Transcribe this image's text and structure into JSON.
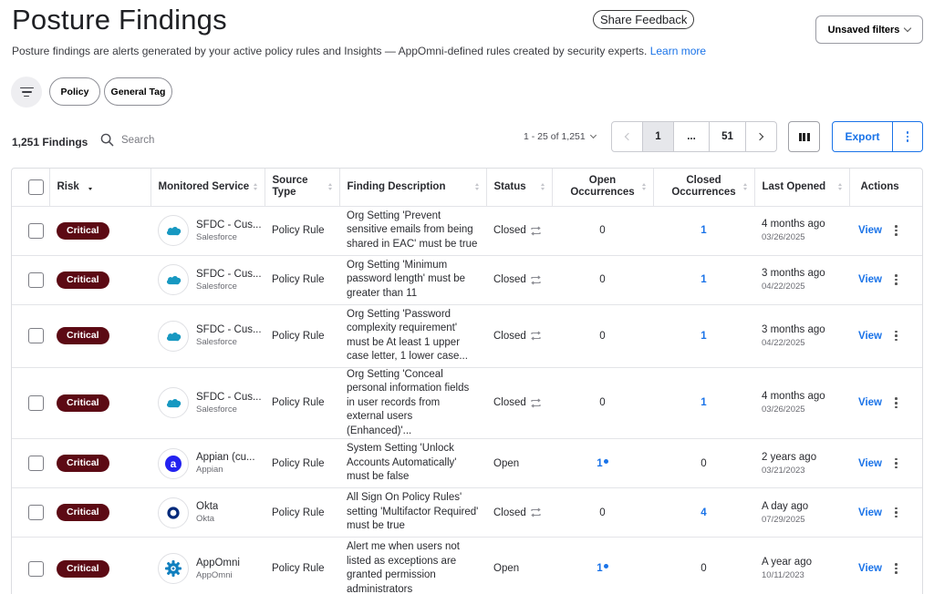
{
  "header": {
    "title": "Posture Findings",
    "feedback_label": "Share Feedback",
    "unsaved_filters_label": "Unsaved filters",
    "subtitle": "Posture findings are alerts generated by your active policy rules and Insights — AppOmni-defined rules created by security experts.",
    "learn_more": "Learn more"
  },
  "filters": {
    "chips": [
      "Policy",
      "General Tag"
    ]
  },
  "toolbar": {
    "findings_count": "1,251 Findings",
    "search_placeholder": "Search",
    "range_label": "1 - 25 of 1,251",
    "pager": {
      "current": "1",
      "ellipsis": "...",
      "last": "51"
    },
    "export_label": "Export"
  },
  "table": {
    "columns": {
      "risk": "Risk",
      "service": "Monitored Service",
      "source": "Source Type",
      "description": "Finding Description",
      "status": "Status",
      "open": "Open Occurrences",
      "closed": "Closed Occurrences",
      "last_opened": "Last Opened",
      "actions": "Actions"
    },
    "rows": [
      {
        "risk": "Critical",
        "service": "SFDC - Cus...",
        "platform": "Salesforce",
        "logo": "salesforce-icon",
        "source": "Policy Rule",
        "desc": "Org Setting 'Prevent sensitive emails from being shared in EAC' must be true",
        "status": "Closed",
        "reopen": true,
        "open": "0",
        "open_new": false,
        "closed": "1",
        "when": "4 months ago",
        "date": "03/26/2025",
        "action": "View"
      },
      {
        "risk": "Critical",
        "service": "SFDC - Cus...",
        "platform": "Salesforce",
        "logo": "salesforce-icon",
        "source": "Policy Rule",
        "desc": "Org Setting 'Minimum password length' must be greater than 11",
        "status": "Closed",
        "reopen": true,
        "open": "0",
        "open_new": false,
        "closed": "1",
        "when": "3 months ago",
        "date": "04/22/2025",
        "action": "View"
      },
      {
        "risk": "Critical",
        "service": "SFDC - Cus...",
        "platform": "Salesforce",
        "logo": "salesforce-icon",
        "source": "Policy Rule",
        "desc": "Org Setting 'Password complexity requirement' must be At least 1 upper case letter, 1 lower case...",
        "status": "Closed",
        "reopen": true,
        "open": "0",
        "open_new": false,
        "closed": "1",
        "when": "3 months ago",
        "date": "04/22/2025",
        "action": "View"
      },
      {
        "risk": "Critical",
        "service": "SFDC - Cus...",
        "platform": "Salesforce",
        "logo": "salesforce-icon",
        "source": "Policy Rule",
        "desc": "Org Setting 'Conceal personal information fields in user records from external users (Enhanced)'...",
        "status": "Closed",
        "reopen": true,
        "open": "0",
        "open_new": false,
        "closed": "1",
        "when": "4 months ago",
        "date": "03/26/2025",
        "action": "View"
      },
      {
        "risk": "Critical",
        "service": "Appian (cu...",
        "platform": "Appian",
        "logo": "appian-icon",
        "source": "Policy Rule",
        "desc": "System Setting 'Unlock Accounts Automatically' must be false",
        "status": "Open",
        "reopen": false,
        "open": "1",
        "open_new": true,
        "closed": "0",
        "when": "2 years ago",
        "date": "03/21/2023",
        "action": "View"
      },
      {
        "risk": "Critical",
        "service": "Okta",
        "platform": "Okta",
        "logo": "okta-icon",
        "source": "Policy Rule",
        "desc": "All Sign On Policy Rules' setting 'Multifactor Required' must be true",
        "status": "Closed",
        "reopen": true,
        "open": "0",
        "open_new": false,
        "closed": "4",
        "when": "A day ago",
        "date": "07/29/2025",
        "action": "View"
      },
      {
        "risk": "Critical",
        "service": "AppOmni",
        "platform": "AppOmni",
        "logo": "appomni-icon",
        "source": "Policy Rule",
        "desc": "Alert me when users not listed as exceptions are granted permission administrators",
        "status": "Open",
        "reopen": false,
        "open": "1",
        "open_new": true,
        "closed": "0",
        "when": "A year ago",
        "date": "10/11/2023",
        "action": "View"
      }
    ]
  },
  "colors": {
    "accent": "#1a73e8",
    "critical": "#5c0a14",
    "salesforce": "#1798c1",
    "appian": "#2322f0",
    "okta": "#00297a",
    "appomni": "#0f7fbf"
  }
}
